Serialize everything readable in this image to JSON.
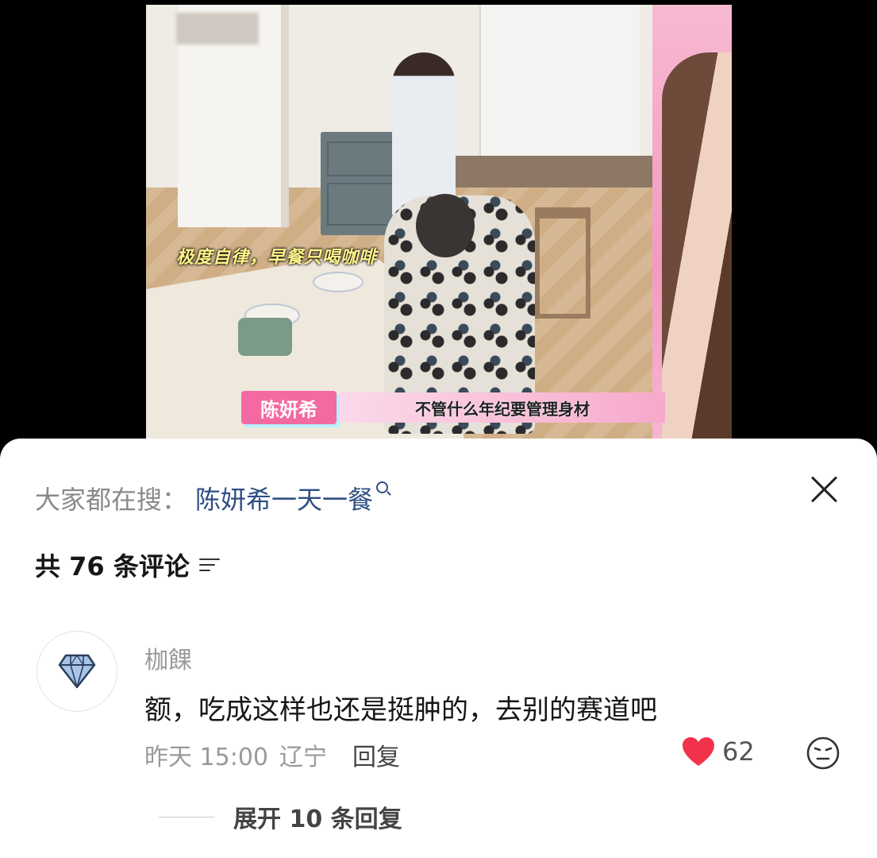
{
  "video": {
    "caption_top": "极度自律，早餐只喝咖啡",
    "name_tag": "陈妍希",
    "subtitle": "不管什么年纪要管理身材"
  },
  "sheet": {
    "search_prefix": "大家都在搜：",
    "search_term": "陈妍希一天一餐",
    "comment_count": "共 76 条评论"
  },
  "comment": {
    "username": "枷餜",
    "text": "额，吃成这样也还是挺肿的，去别的赛道吧",
    "time": "昨天 15:00",
    "location": "辽宁",
    "reply_label": "回复",
    "likes": "62",
    "like_color": "#f0334a"
  },
  "replies": {
    "expand_label": "展开 10 条回复"
  },
  "icons": {
    "close": "close-icon",
    "sort": "sort-icon",
    "search": "search-icon",
    "heart": "heart-icon",
    "emoji": "emoji-face-icon",
    "avatar": "diamond-icon"
  }
}
